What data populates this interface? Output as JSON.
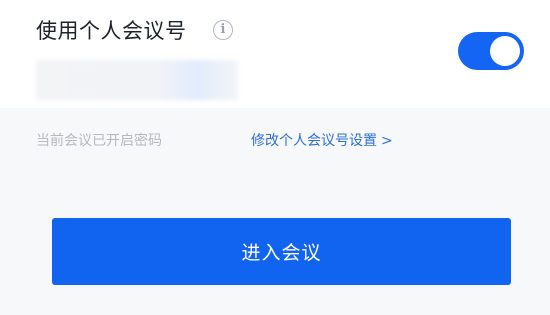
{
  "personal_meeting": {
    "label": "使用个人会议号",
    "info_icon": "info-icon",
    "info_glyph": "i",
    "toggle_on": true,
    "meeting_id": ""
  },
  "password": {
    "status_text": "当前会议已开启密码",
    "modify_link_text": "修改个人会议号设置",
    "modify_link_chevron": ">"
  },
  "actions": {
    "enter_label": "进入会议"
  },
  "colors": {
    "accent": "#1064f0",
    "toggle_on": "#1565f5",
    "link": "#2f6fd6",
    "muted_text": "#b6b9bf",
    "background": "#f7f8fa"
  }
}
